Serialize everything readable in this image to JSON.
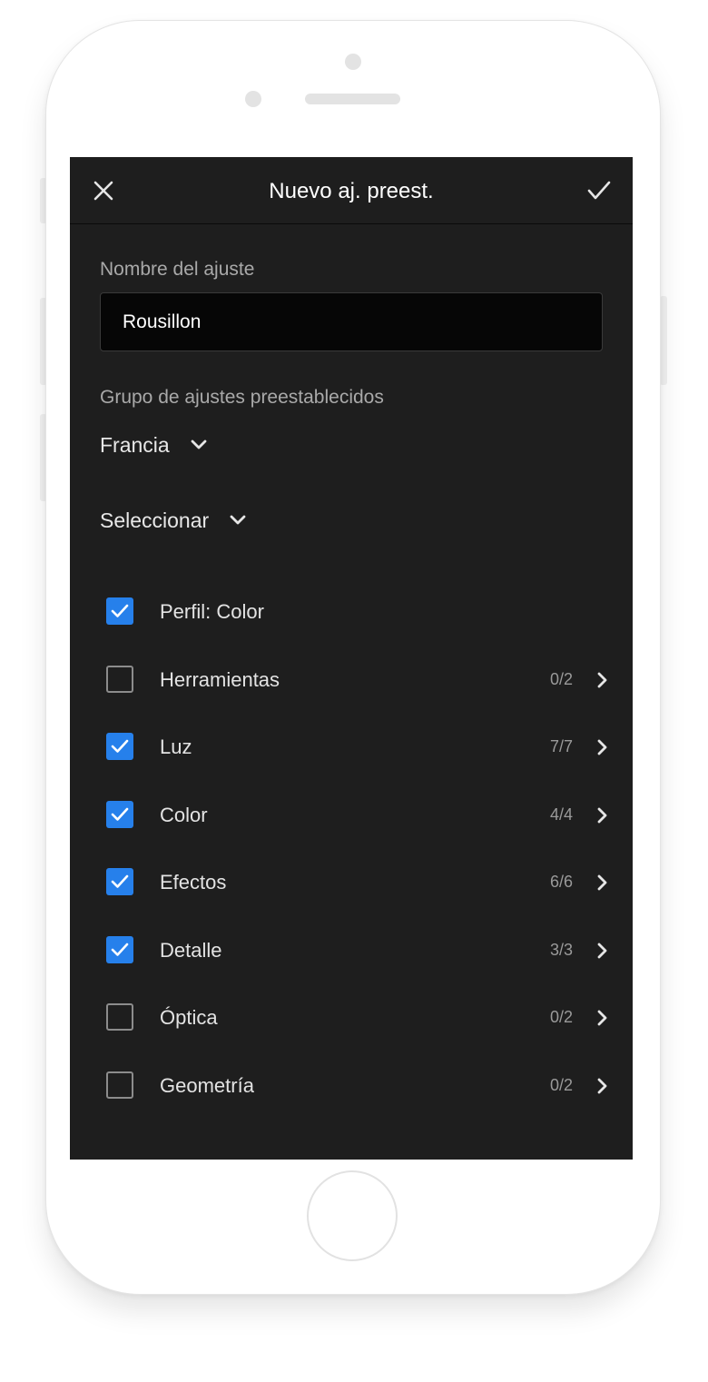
{
  "header": {
    "title": "Nuevo aj. preest."
  },
  "preset_name": {
    "label": "Nombre del ajuste",
    "value": "Rousillon"
  },
  "preset_group": {
    "label": "Grupo de ajustes preestablecidos",
    "selected": "Francia"
  },
  "select_menu": {
    "label": "Seleccionar"
  },
  "settings": [
    {
      "label": "Perfil: Color",
      "checked": true,
      "count": ""
    },
    {
      "label": "Herramientas",
      "checked": false,
      "count": "0/2"
    },
    {
      "label": "Luz",
      "checked": true,
      "count": "7/7"
    },
    {
      "label": "Color",
      "checked": true,
      "count": "4/4"
    },
    {
      "label": "Efectos",
      "checked": true,
      "count": "6/6"
    },
    {
      "label": "Detalle",
      "checked": true,
      "count": "3/3"
    },
    {
      "label": "Óptica",
      "checked": false,
      "count": "0/2"
    },
    {
      "label": "Geometría",
      "checked": false,
      "count": "0/2"
    }
  ],
  "colors": {
    "accent": "#2680eb",
    "screen_bg": "#1e1e1e",
    "input_bg": "#060606"
  },
  "icons": {
    "close": "close-icon",
    "confirm": "checkmark-icon",
    "dropdown": "chevron-down-icon",
    "row_nav": "chevron-right-icon"
  }
}
